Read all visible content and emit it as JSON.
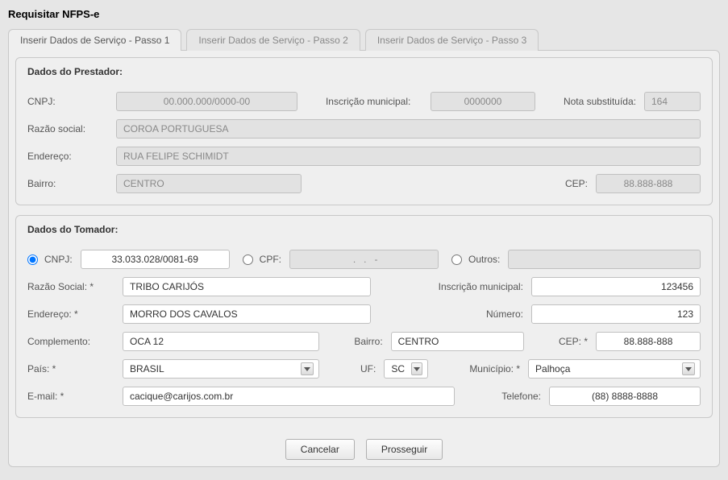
{
  "title": "Requisitar NFPS-e",
  "tabs": {
    "t1": "Inserir Dados de Serviço - Passo 1",
    "t2": "Inserir Dados de Serviço - Passo 2",
    "t3": "Inserir Dados de Serviço - Passo 3"
  },
  "prestador": {
    "legend": "Dados do Prestador:",
    "cnpj_label": "CNPJ:",
    "cnpj": "00.000.000/0000-00",
    "insc_label": "Inscrição municipal:",
    "insc": "0000000",
    "nota_label": "Nota substituída:",
    "nota": "164",
    "razao_label": "Razão social:",
    "razao": "COROA PORTUGUESA",
    "endereco_label": "Endereço:",
    "endereco": "RUA FELIPE SCHIMIDT",
    "bairro_label": "Bairro:",
    "bairro": "CENTRO",
    "cep_label": "CEP:",
    "cep": "88.888-888"
  },
  "tomador": {
    "legend": "Dados do Tomador:",
    "opt_cnpj": "CNPJ:",
    "cnpj": "33.033.028/0081-69",
    "opt_cpf": "CPF:",
    "cpf": "   .   .   -  ",
    "opt_outros": "Outros:",
    "outros": "",
    "razao_label": "Razão Social: *",
    "razao": "TRIBO CARIJÓS",
    "insc_label": "Inscrição municipal:",
    "insc": "123456",
    "endereco_label": "Endereço: *",
    "endereco": "MORRO DOS CAVALOS",
    "numero_label": "Número:",
    "numero": "123",
    "complemento_label": "Complemento:",
    "complemento": "OCA 12",
    "bairro_label": "Bairro:",
    "bairro": "CENTRO",
    "cep_label": "CEP: *",
    "cep": "88.888-888",
    "pais_label": "País: *",
    "pais": "BRASIL",
    "uf_label": "UF:",
    "uf": "SC",
    "municipio_label": "Município: *",
    "municipio": "Palhoça",
    "email_label": "E-mail: *",
    "email": "cacique@carijos.com.br",
    "telefone_label": "Telefone:",
    "telefone": "(88) 8888-8888"
  },
  "actions": {
    "cancel": "Cancelar",
    "proceed": "Prosseguir"
  }
}
